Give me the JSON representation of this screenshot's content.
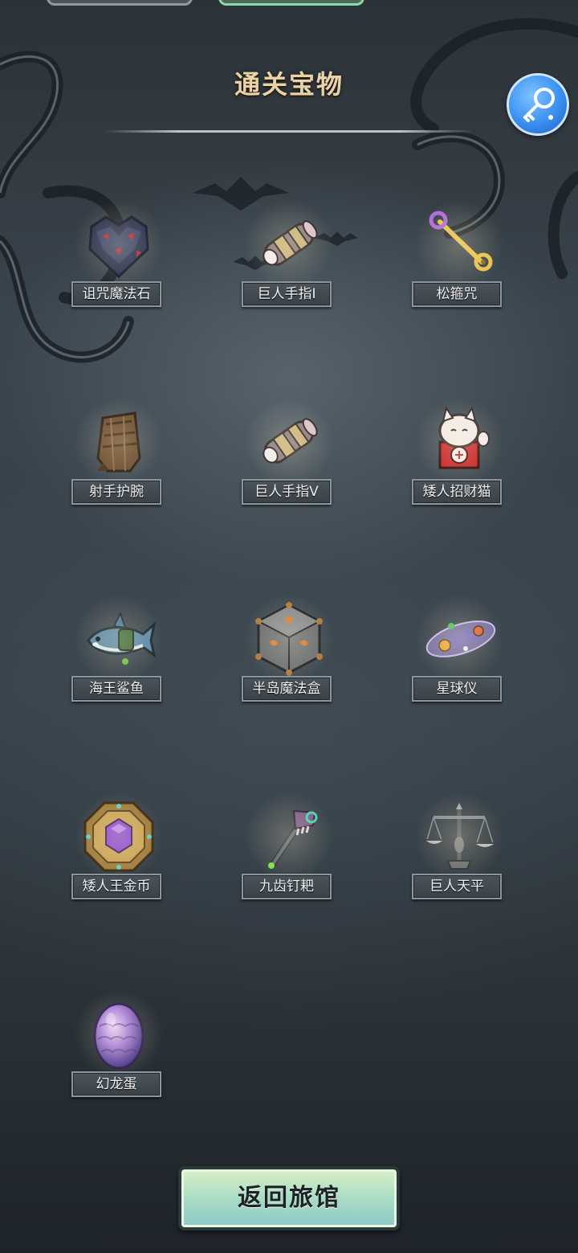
{
  "header": {
    "title": "通关宝物"
  },
  "colors": {
    "title": "#e9d4aa",
    "label_bg": "#3a4248",
    "key_button": "#3a8ff0",
    "return_button": "#a9dcc4"
  },
  "key_button": {
    "icon": "key-icon"
  },
  "items": [
    {
      "label": "诅咒魔法石",
      "icon": "cursed-stone-icon"
    },
    {
      "label": "巨人手指I",
      "icon": "giant-finger-icon"
    },
    {
      "label": "松箍咒",
      "icon": "golden-staff-icon"
    },
    {
      "label": "射手护腕",
      "icon": "bracer-icon"
    },
    {
      "label": "巨人手指V",
      "icon": "giant-finger-icon"
    },
    {
      "label": "矮人招财猫",
      "icon": "lucky-cat-icon"
    },
    {
      "label": "海王鲨鱼",
      "icon": "shark-icon"
    },
    {
      "label": "半岛魔法盒",
      "icon": "magic-box-icon"
    },
    {
      "label": "星球仪",
      "icon": "orrery-icon"
    },
    {
      "label": "矮人王金币",
      "icon": "gold-coin-icon"
    },
    {
      "label": "九齿钉耙",
      "icon": "rake-icon"
    },
    {
      "label": "巨人天平",
      "icon": "scales-icon"
    },
    {
      "label": "幻龙蛋",
      "icon": "dragon-egg-icon"
    }
  ],
  "footer": {
    "return_label": "返回旅馆"
  }
}
